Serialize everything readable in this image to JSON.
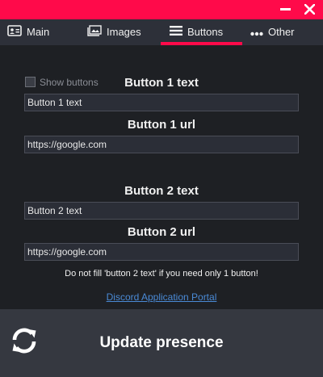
{
  "titlebar": {
    "minimize_icon": "minimize-icon",
    "close_icon": "close-icon",
    "color": "#ff0a4a"
  },
  "tabs": [
    {
      "label": "Main",
      "icon": "id-card-icon",
      "active": false
    },
    {
      "label": "Images",
      "icon": "image-icon",
      "active": false
    },
    {
      "label": "Buttons",
      "icon": "hamburger-icon",
      "active": true
    },
    {
      "label": "Other",
      "icon": "ellipsis-icon",
      "active": false
    }
  ],
  "buttons_page": {
    "show_buttons_label": "Show buttons",
    "show_buttons_checked": false,
    "button1_text_label": "Button 1 text",
    "button1_text_value": "Button 1 text",
    "button1_url_label": "Button 1 url",
    "button1_url_value": "https://google.com",
    "button2_text_label": "Button 2 text",
    "button2_text_value": "Button 2 text",
    "button2_url_label": "Button 2 url",
    "button2_url_value": "https://google.com",
    "hint": "Do not fill 'button 2 text' if you need only 1 button!",
    "portal_link": "Discord Application Portal"
  },
  "footer": {
    "update_label": "Update presence",
    "icon": "refresh-icon"
  }
}
